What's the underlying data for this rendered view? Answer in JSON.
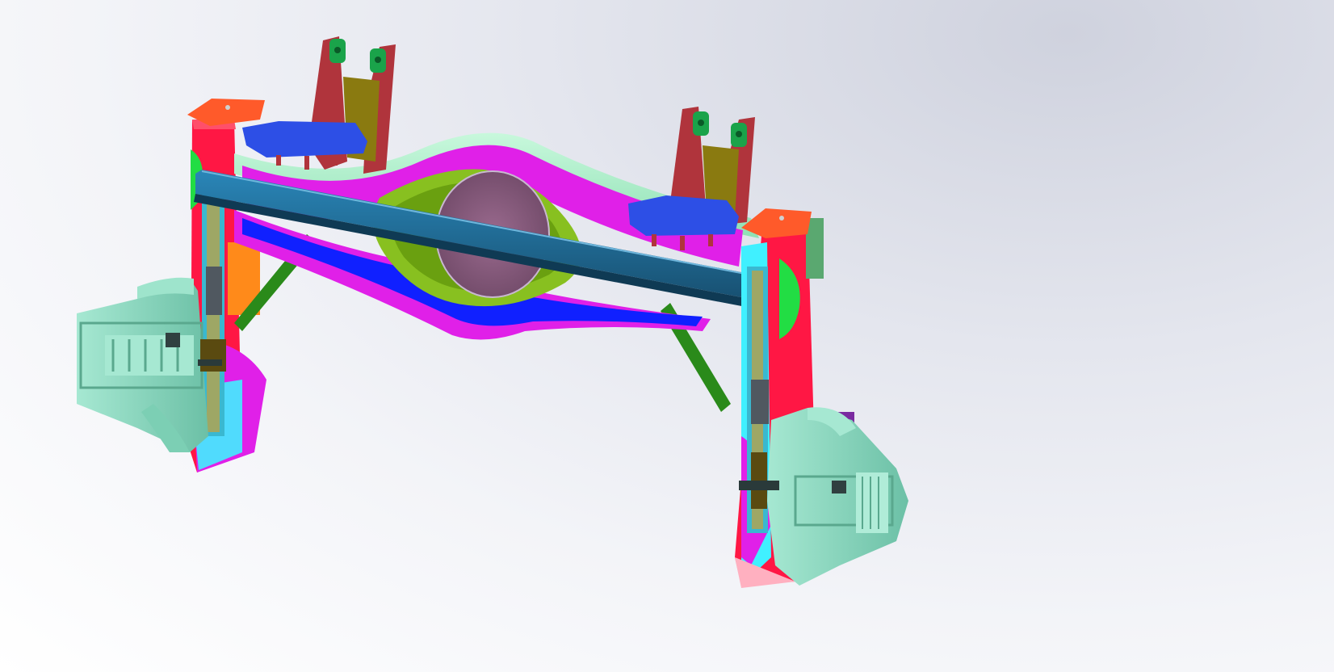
{
  "viewport": {
    "background_top": "#cfd2de",
    "background_bottom": "#ffffff"
  },
  "model": {
    "colors": {
      "frame_red": "#ff1744",
      "bracket_red": "#b0343c",
      "tab_green": "#1aa34a",
      "plate_blue": "#2d4fe6",
      "beam_steel": "#1f6f9a",
      "arch_magenta": "#e020e8",
      "arch_blue": "#1020ff",
      "arch_mint": "#a8f0c8",
      "housing_green": "#88c020",
      "cover_violet": "#8a5a7e",
      "hub_teal": "#8fd8c0",
      "panel_cyan": "#40f0ff",
      "strut_green": "#2a8a1a",
      "accent_orange": "#ff8a1a",
      "accent_purple": "#7a2aa0",
      "plate_orange": "#ff5a2a",
      "olive": "#8a7a10"
    }
  }
}
